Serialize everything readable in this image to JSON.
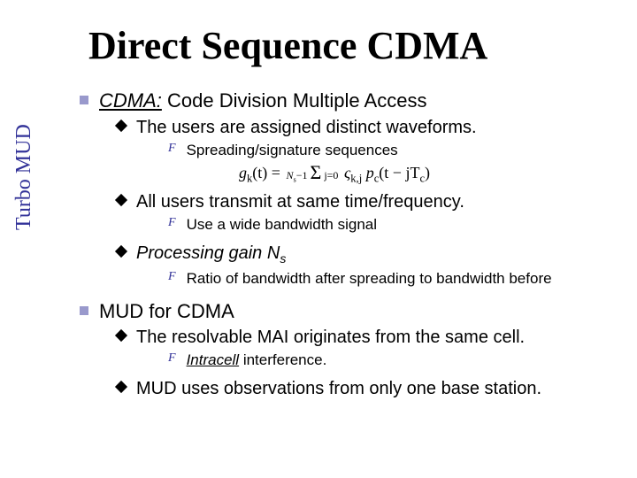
{
  "sidebar_label": "Turbo MUD",
  "title": "Direct Sequence CDMA",
  "s1": {
    "heading_lead": "CDMA:",
    "heading_rest": " Code Division Multiple Access",
    "b1": "The users are assigned distinct waveforms.",
    "b1_1": "Spreading/signature sequences",
    "eq_lhs": "g",
    "eq_lhs_sub": "k",
    "eq_lhs_arg": "(t)",
    "eq_sum_top": "N",
    "eq_sum_top_sub": "s",
    "eq_sum_top_suffix": "−1",
    "eq_sum_bot": "j=0",
    "eq_rhs1": "ς",
    "eq_rhs1_sub": "k,j",
    "eq_rhs2": " p",
    "eq_rhs2_sub": "c",
    "eq_rhs3": "(t − jT",
    "eq_rhs3_sub": "c",
    "eq_rhs4": ")",
    "b2": "All users transmit at same time/frequency.",
    "b2_1": "Use a wide bandwidth signal",
    "b3_lead": "Processing gain ",
    "b3_tail": "N",
    "b3_tail_sub": "s",
    "b3_1": "Ratio of bandwidth after spreading to bandwidth before"
  },
  "s2": {
    "heading": "MUD for CDMA",
    "b1": "The resolvable MAI originates from the same cell.",
    "b1_1_lead": "Intracell",
    "b1_1_rest": " interference.",
    "b2": "MUD uses observations from only one base station."
  }
}
